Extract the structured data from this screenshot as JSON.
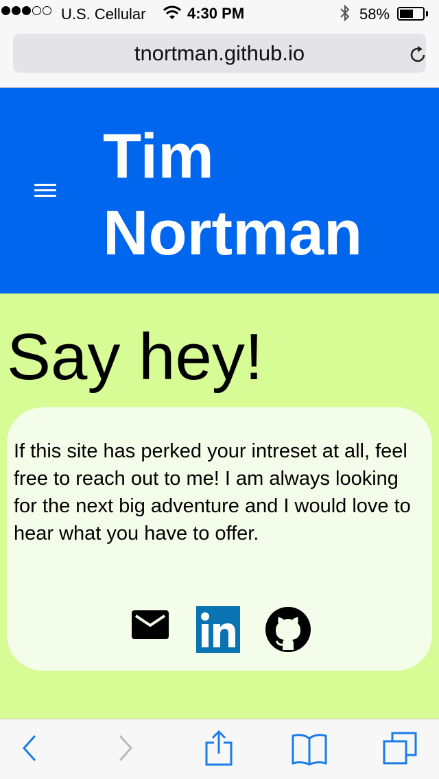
{
  "status_bar": {
    "carrier": "U.S. Cellular",
    "time": "4:30 PM",
    "battery": "58%",
    "battery_level": 0.58,
    "signal_bars_filled": 3,
    "signal_bars_total": 5
  },
  "browser": {
    "url": "tnortman.github.io"
  },
  "header": {
    "title": "Tim Nortman",
    "background_color": "#0066ee"
  },
  "main": {
    "heading": "Say hey!",
    "message": "If this site has perked your intreset at all, feel free to reach out to me! I am always looking for the next big adventure and I would love to hear what you have to offer.",
    "background_color": "#d7fb95",
    "social_links": [
      "mail-icon",
      "linkedin-icon",
      "github-icon"
    ]
  },
  "toolbar": {
    "icons": [
      "back-icon",
      "forward-icon",
      "share-icon",
      "bookmarks-icon",
      "tabs-icon"
    ],
    "accent_color": "#1a7ce8"
  }
}
